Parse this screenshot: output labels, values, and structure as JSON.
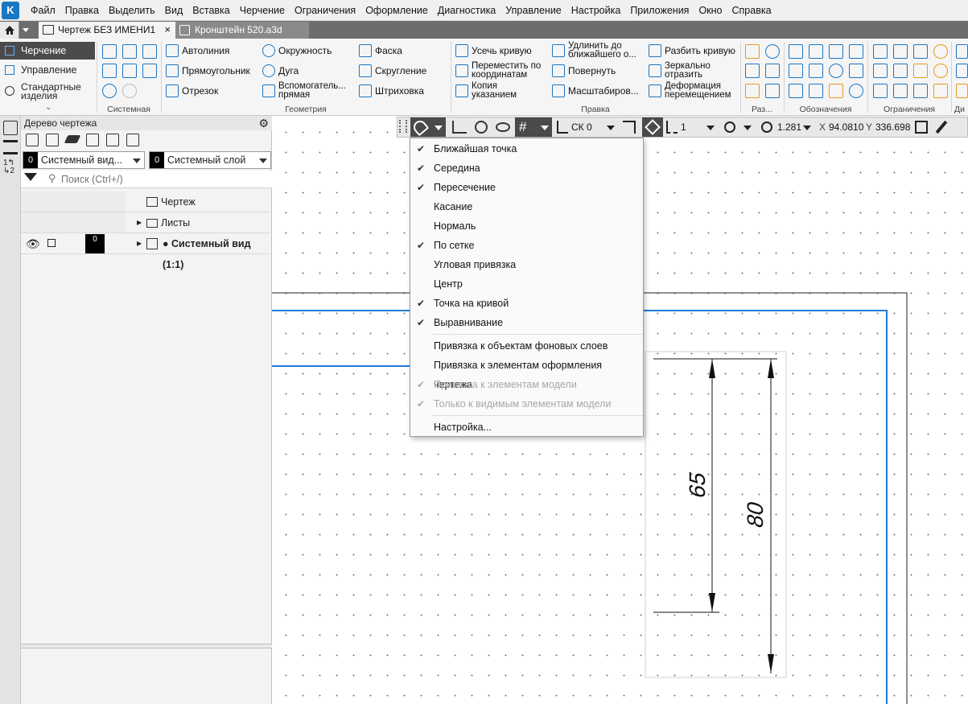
{
  "menubar": {
    "items": [
      "Файл",
      "Правка",
      "Выделить",
      "Вид",
      "Вставка",
      "Черчение",
      "Ограничения",
      "Оформление",
      "Диагностика",
      "Управление",
      "Настройка",
      "Приложения",
      "Окно",
      "Справка"
    ]
  },
  "tabs": {
    "active": "Чертеж БЕЗ ИМЕНИ1",
    "other": "Кронштейн 520.a3d"
  },
  "ribbon": {
    "left_items": [
      "Черчение",
      "Управление",
      "Стандартные изделия"
    ],
    "geometry": {
      "col1": [
        "Автолиния",
        "Прямоугольник",
        "Отрезок"
      ],
      "col2": [
        "Окружность",
        "Дуга",
        "Вспомогатель... прямая"
      ],
      "col3": [
        "Фаска",
        "Скругление",
        "Штриховка"
      ]
    },
    "edit": {
      "col1": [
        "Усечь кривую",
        "Переместить по координатам",
        "Копия указанием"
      ],
      "col2": [
        "Удлинить до ближайшего о...",
        "Повернуть",
        "Масштабиров..."
      ],
      "col3": [
        "Разбить кривую",
        "Зеркально отразить",
        "Деформация перемещением"
      ]
    },
    "captions": [
      "Системная",
      "Геометрия",
      "Правка",
      "Раз...",
      "Обозначения",
      "Ограничения",
      "Ди"
    ]
  },
  "panel": {
    "title": "Дерево чертежа",
    "view_dropdown": {
      "num": "0",
      "value": "Системный вид..."
    },
    "layer_dropdown": {
      "num": "0",
      "value": "Системный слой"
    },
    "search_placeholder": "Поиск (Ctrl+/)",
    "tree": [
      "Чертеж",
      "Листы",
      "● Системный вид (1:1)"
    ],
    "view_layer_num": "0"
  },
  "canvas_toolbar": {
    "cs": "СК 0",
    "step": "1",
    "zoom": "1.281",
    "x_label": "X",
    "x_value": "94.0810",
    "y_label": "Y",
    "y_value": "336.6980"
  },
  "snap_menu": {
    "items": [
      {
        "label": "Ближайшая точка",
        "checked": true,
        "disabled": false
      },
      {
        "label": "Середина",
        "checked": true,
        "disabled": false
      },
      {
        "label": "Пересечение",
        "checked": true,
        "disabled": false
      },
      {
        "label": "Касание",
        "checked": false,
        "disabled": false
      },
      {
        "label": "Нормаль",
        "checked": false,
        "disabled": false
      },
      {
        "label": "По сетке",
        "checked": true,
        "disabled": false
      },
      {
        "label": "Угловая привязка",
        "checked": false,
        "disabled": false
      },
      {
        "label": "Центр",
        "checked": false,
        "disabled": false
      },
      {
        "label": "Точка на кривой",
        "checked": true,
        "disabled": false
      },
      {
        "label": "Выравнивание",
        "checked": true,
        "disabled": false
      }
    ],
    "items2": [
      {
        "label": "Привязка к объектам фоновых слоев",
        "checked": false,
        "disabled": false
      },
      {
        "label": "Привязка к элементам оформления чертежа",
        "checked": false,
        "disabled": false
      },
      {
        "label": "Привязка к элементам модели",
        "checked": true,
        "disabled": true
      },
      {
        "label": "Только к видимым элементам модели",
        "checked": true,
        "disabled": true
      }
    ],
    "settings": "Настройка..."
  },
  "drawing": {
    "dim1": "65",
    "dim2": "80"
  },
  "colors": {
    "accent": "#1b76c3",
    "frame_blue": "#1f7ad6"
  }
}
